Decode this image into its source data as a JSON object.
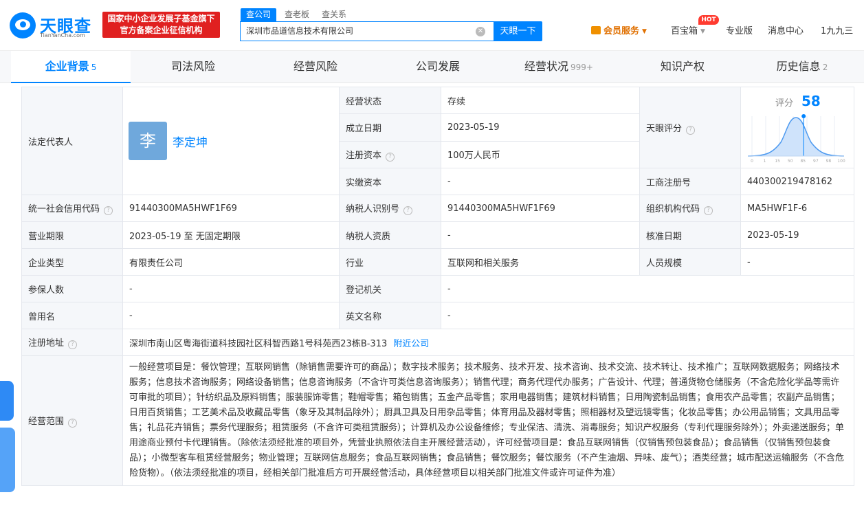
{
  "header": {
    "logo_text": "天眼查",
    "logo_sub": "TianYanCha.com",
    "banner_line1": "国家中小企业发展子基金旗下",
    "banner_line2": "官方备案企业征信机构",
    "search_tabs": [
      "查公司",
      "查老板",
      "查关系"
    ],
    "search_value": "深圳市品道信息技术有限公司",
    "search_button": "天眼一下",
    "nav": {
      "vip": "会员服务",
      "box": "百宝箱",
      "hot": "HOT",
      "pro": "专业版",
      "messages": "消息中心",
      "user": "1九九三"
    }
  },
  "tabs": [
    {
      "label": "企业背景",
      "count": "5"
    },
    {
      "label": "司法风险",
      "count": ""
    },
    {
      "label": "经营风险",
      "count": ""
    },
    {
      "label": "公司发展",
      "count": ""
    },
    {
      "label": "经营状况",
      "count": "999+"
    },
    {
      "label": "知识产权",
      "count": ""
    },
    {
      "label": "历史信息",
      "count": "2"
    }
  ],
  "info": {
    "legal_rep_label": "法定代表人",
    "legal_rep_avatar": "李",
    "legal_rep_name": "李定坤",
    "status_label": "经营状态",
    "status_value": "存续",
    "founded_label": "成立日期",
    "founded_value": "2023-05-19",
    "capital_label": "注册资本",
    "capital_value": "100万人民币",
    "paid_capital_label": "实缴资本",
    "paid_capital_value": "-",
    "score_row_label": "天眼评分",
    "score_title": "评分",
    "score_value": "58",
    "score_level": 0.58,
    "score_ticks": [
      "0",
      "1",
      "15",
      "50",
      "85",
      "97",
      "98",
      "100"
    ],
    "reg_no_label": "工商注册号",
    "reg_no_value": "440300219478162",
    "credit_code_label": "统一社会信用代码",
    "credit_code_value": "91440300MA5HWF1F69",
    "taxpayer_id_label": "纳税人识别号",
    "taxpayer_id_value": "91440300MA5HWF1F69",
    "org_code_label": "组织机构代码",
    "org_code_value": "MA5HWF1F-6",
    "term_label": "营业期限",
    "term_value": "2023-05-19 至 无固定期限",
    "taxpayer_qual_label": "纳税人资质",
    "taxpayer_qual_value": "-",
    "approval_date_label": "核准日期",
    "approval_date_value": "2023-05-19",
    "type_label": "企业类型",
    "type_value": "有限责任公司",
    "industry_label": "行业",
    "industry_value": "互联网和相关服务",
    "staff_label": "人员规模",
    "staff_value": "-",
    "insured_label": "参保人数",
    "insured_value": "-",
    "authority_label": "登记机关",
    "authority_value": "-",
    "former_name_label": "曾用名",
    "former_name_value": "-",
    "english_name_label": "英文名称",
    "english_name_value": "-",
    "address_label": "注册地址",
    "address_value": "深圳市南山区粤海街道科技园社区科智西路1号科苑西23栋B-313",
    "nearby_link": "附近公司",
    "scope_label": "经营范围",
    "scope_value": "一般经营项目是：餐饮管理；互联网销售（除销售需要许可的商品）；数字技术服务；技术服务、技术开发、技术咨询、技术交流、技术转让、技术推广；互联网数据服务；网络技术服务；信息技术咨询服务；网络设备销售；信息咨询服务（不含许可类信息咨询服务）；销售代理；商务代理代办服务；广告设计、代理；普通货物仓储服务（不含危险化学品等需许可审批的项目）；针纺织品及原料销售；服装服饰零售；鞋帽零售；箱包销售；五金产品零售；家用电器销售；建筑材料销售；日用陶瓷制品销售；食用农产品零售；农副产品销售；日用百货销售；工艺美术品及收藏品零售（象牙及其制品除外）；厨具卫具及日用杂品零售；体育用品及器材零售；照相器材及望远镜零售；化妆品零售；办公用品销售；文具用品零售；礼品花卉销售；票务代理服务；租赁服务（不含许可类租赁服务）；计算机及办公设备维修；专业保洁、清洗、消毒服务；知识产权服务（专利代理服务除外）；外卖递送服务；单用途商业预付卡代理销售。（除依法须经批准的项目外，凭营业执照依法自主开展经营活动），许可经营项目是：食品互联网销售（仅销售预包装食品）；食品销售（仅销售预包装食品）；小微型客车租赁经营服务；物业管理；互联网信息服务；食品互联网销售；食品销售；餐饮服务；餐饮服务（不产生油烟、异味、废气）；酒类经营；城市配送运输服务（不含危险货物）。（依法须经批准的项目，经相关部门批准后方可开展经营活动，具体经营项目以相关部门批准文件或许可证件为准）"
  }
}
